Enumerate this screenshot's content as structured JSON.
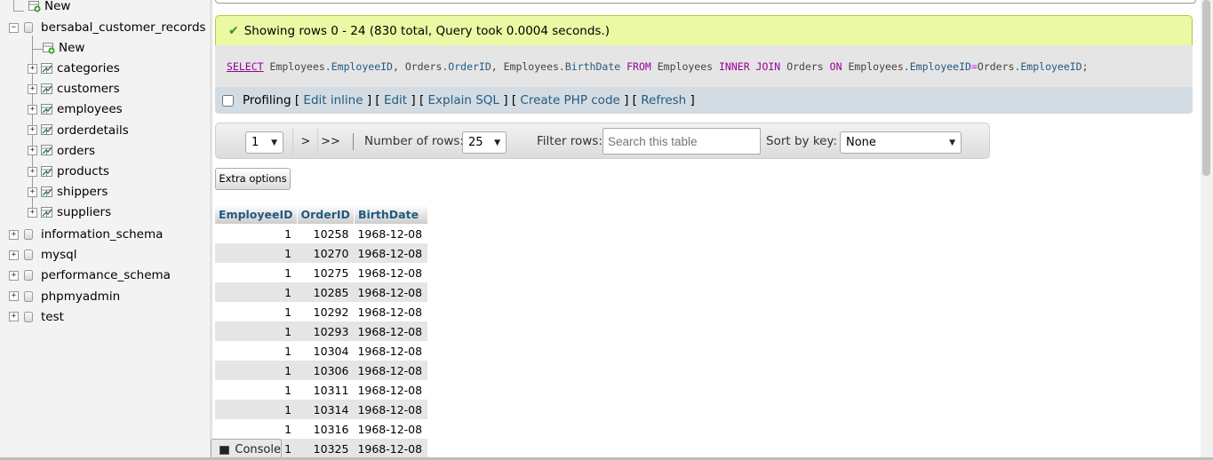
{
  "nav": {
    "new_top_label": "New",
    "db_name": "bersabal_customer_records",
    "new_table_label": "New",
    "tables": [
      "categories",
      "customers",
      "employees",
      "orderdetails",
      "orders",
      "products",
      "shippers",
      "suppliers"
    ],
    "other_dbs": [
      "information_schema",
      "mysql",
      "performance_schema",
      "phpmyadmin",
      "test"
    ]
  },
  "message": {
    "success": "Showing rows 0 - 24 (830 total, Query took 0.0004 seconds.)"
  },
  "sql": {
    "select": "SELECT",
    "t1": "Employees.",
    "c1": "EmployeeID",
    "t2": ", Orders.",
    "c2": "OrderID",
    "t3": ", Employees.",
    "c3": "BirthDate",
    "from": "FROM",
    "t4": "Employees",
    "inner": "INNER JOIN",
    "t5": "Orders",
    "on": "ON",
    "t6": "Employees.",
    "c4": "EmployeeID",
    "eq": "=",
    "t7": "Orders.",
    "c5": "EmployeeID",
    "end": ";"
  },
  "toolbar": {
    "profiling": "Profiling",
    "edit_inline": "Edit inline",
    "edit": "Edit",
    "explain": "Explain SQL",
    "create_php": "Create PHP code",
    "refresh": "Refresh"
  },
  "navbar": {
    "page": "1",
    "next": ">",
    "last": ">>",
    "rows_label": "Number of rows:",
    "rows_value": "25",
    "filter_label": "Filter rows:",
    "filter_placeholder": "Search this table",
    "sort_label": "Sort by key:",
    "sort_value": "None"
  },
  "extra_options": "Extra options",
  "table": {
    "headers": [
      "EmployeeID",
      "OrderID",
      "BirthDate"
    ],
    "rows": [
      [
        "1",
        "10258",
        "1968-12-08"
      ],
      [
        "1",
        "10270",
        "1968-12-08"
      ],
      [
        "1",
        "10275",
        "1968-12-08"
      ],
      [
        "1",
        "10285",
        "1968-12-08"
      ],
      [
        "1",
        "10292",
        "1968-12-08"
      ],
      [
        "1",
        "10293",
        "1968-12-08"
      ],
      [
        "1",
        "10304",
        "1968-12-08"
      ],
      [
        "1",
        "10306",
        "1968-12-08"
      ],
      [
        "1",
        "10311",
        "1968-12-08"
      ],
      [
        "1",
        "10314",
        "1968-12-08"
      ],
      [
        "1",
        "10316",
        "1968-12-08"
      ],
      [
        "1",
        "10325",
        "1968-12-08"
      ]
    ]
  },
  "console": "Console"
}
